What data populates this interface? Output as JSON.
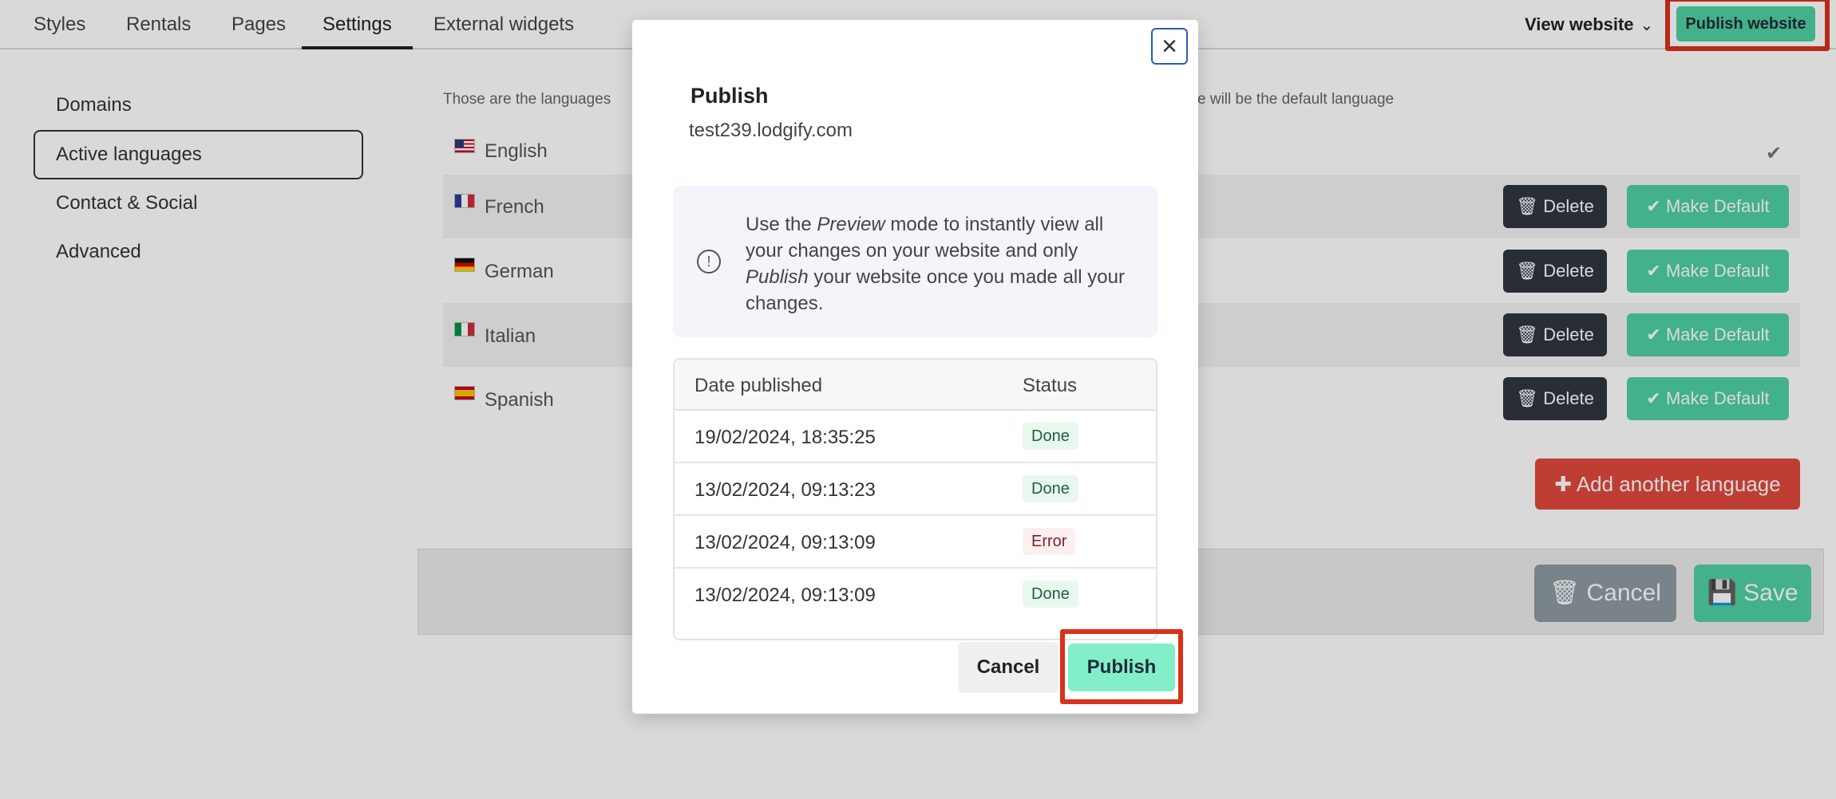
{
  "topbar": {
    "tabs": [
      {
        "label": "Styles"
      },
      {
        "label": "Rentals"
      },
      {
        "label": "Pages"
      },
      {
        "label": "Settings",
        "active": true
      },
      {
        "label": "External widgets"
      }
    ],
    "view_website_label": "View website",
    "publish_website_label": "Publish website"
  },
  "leftnav": {
    "items": [
      {
        "label": "Domains"
      },
      {
        "label": "Active languages",
        "active": true
      },
      {
        "label": "Contact & Social"
      },
      {
        "label": "Advanced"
      }
    ]
  },
  "languages": {
    "description_left": "Those are the languages",
    "description_right": "e will be the default language",
    "rows": [
      {
        "name": "English",
        "flag": "us-flag-icon",
        "is_default": true
      },
      {
        "name": "French",
        "flag": "fr-flag-icon"
      },
      {
        "name": "German",
        "flag": "de-flag-icon"
      },
      {
        "name": "Italian",
        "flag": "it-flag-icon"
      },
      {
        "name": "Spanish",
        "flag": "es-flag-icon"
      }
    ],
    "delete_label": "Delete",
    "make_default_label": "Make Default",
    "add_language_label": "Add another language"
  },
  "footer": {
    "cancel_label": "Cancel",
    "save_label": "Save"
  },
  "modal": {
    "title": "Publish",
    "subtitle": "test239.lodgify.com",
    "info": {
      "t1": "Use the ",
      "t2": "Preview",
      "t3": " mode to instantly view all your changes on your website and only ",
      "t4": "Publish",
      "t5": " your website once you made all your changes."
    },
    "history": {
      "col_date": "Date published",
      "col_status": "Status",
      "rows": [
        {
          "date": "19/02/2024, 18:35:25",
          "status": "Done"
        },
        {
          "date": "13/02/2024, 09:13:23",
          "status": "Done"
        },
        {
          "date": "13/02/2024, 09:13:09",
          "status": "Error"
        },
        {
          "date": "13/02/2024, 09:13:09",
          "status": "Done"
        }
      ]
    },
    "cancel_label": "Cancel",
    "publish_label": "Publish"
  },
  "colors": {
    "accent_green": "#4fd1a1",
    "publish_green": "#82efca",
    "danger_red": "#e0493e",
    "highlight_red": "#d9311a",
    "dark_button": "#2f3640"
  }
}
